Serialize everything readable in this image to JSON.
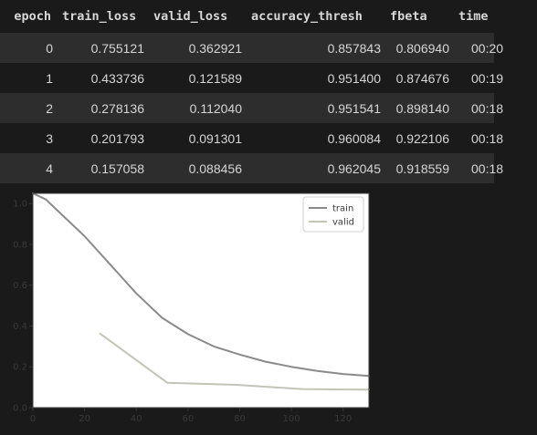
{
  "table": {
    "headers": [
      "epoch",
      "train_loss",
      "valid_loss",
      "accuracy_thresh",
      "fbeta",
      "time"
    ],
    "rows": [
      [
        "0",
        "0.755121",
        "0.362921",
        "0.857843",
        "0.806940",
        "00:20"
      ],
      [
        "1",
        "0.433736",
        "0.121589",
        "0.951400",
        "0.874676",
        "00:19"
      ],
      [
        "2",
        "0.278136",
        "0.112040",
        "0.951541",
        "0.898140",
        "00:18"
      ],
      [
        "3",
        "0.201793",
        "0.091301",
        "0.960084",
        "0.922106",
        "00:18"
      ],
      [
        "4",
        "0.157058",
        "0.088456",
        "0.962045",
        "0.918559",
        "00:18"
      ]
    ]
  },
  "chart_data": {
    "type": "line",
    "xlim": [
      0,
      130
    ],
    "ylim": [
      0,
      1.05
    ],
    "xticks": [
      "0",
      "20",
      "40",
      "60",
      "80",
      "100",
      "120"
    ],
    "yticks": [
      "0.0",
      "0.2",
      "0.4",
      "0.6",
      "0.8",
      "1.0"
    ],
    "grid": false,
    "legend_position": "top-right",
    "series": [
      {
        "name": "train",
        "color": "#8a8a8a",
        "x": [
          0,
          5,
          10,
          20,
          30,
          40,
          50,
          60,
          70,
          80,
          90,
          100,
          110,
          120,
          130
        ],
        "y": [
          1.05,
          1.02,
          0.96,
          0.84,
          0.7,
          0.56,
          0.44,
          0.36,
          0.3,
          0.26,
          0.225,
          0.2,
          0.18,
          0.165,
          0.155
        ]
      },
      {
        "name": "valid",
        "color": "#c3c3b8",
        "x": [
          26,
          52,
          78,
          104,
          130
        ],
        "y": [
          0.363,
          0.122,
          0.112,
          0.091,
          0.088
        ]
      }
    ]
  }
}
